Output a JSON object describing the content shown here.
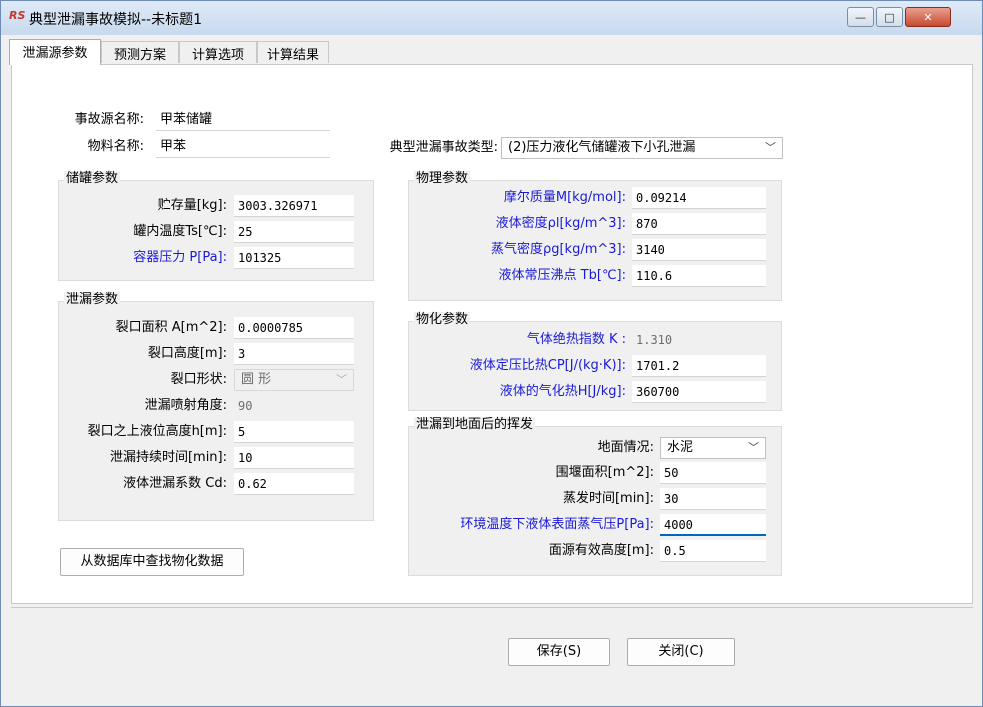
{
  "window": {
    "title": "典型泄漏事故模拟--未标题1",
    "app_icon": "RS"
  },
  "tabs": [
    "泄漏源参数",
    "预测方案",
    "计算选项",
    "计算结果"
  ],
  "form": {
    "source_name_label": "事故源名称:",
    "source_name": "甲苯储罐",
    "material_label": "物料名称:",
    "material": "甲苯",
    "accident_type_label": "典型泄漏事故类型:",
    "accident_type": "(2)压力液化气储罐液下小孔泄漏"
  },
  "tank": {
    "title": "储罐参数",
    "storage_label": "贮存量[kg]:",
    "storage": "3003.326971",
    "temp_label": "罐内温度Ts[℃]:",
    "temp": "25",
    "pressure_label": "容器压力 P[Pa]:",
    "pressure": "101325"
  },
  "leak": {
    "title": "泄漏参数",
    "area_label": "裂口面积 A[m^2]:",
    "area": "0.0000785",
    "height_label": "裂口高度[m]:",
    "height": "3",
    "shape_label": "裂口形状:",
    "shape": "圆  形",
    "angle_label": "泄漏喷射角度:",
    "angle": "90",
    "level_label": "裂口之上液位高度h[m]:",
    "level": "5",
    "duration_label": "泄漏持续时间[min]:",
    "duration": "10",
    "coef_label": "液体泄漏系数  Cd:",
    "coef": "0.62"
  },
  "physical": {
    "title": "物理参数",
    "molar_label": "摩尔质量M[kg/mol]:",
    "molar": "0.09214",
    "liquid_density_label": "液体密度ρl[kg/m^3]:",
    "liquid_density": "870",
    "vapor_density_label": "蒸气密度ρg[kg/m^3]:",
    "vapor_density": "3140",
    "boiling_label": "液体常压沸点 Tb[℃]:",
    "boiling": "110.6"
  },
  "chemical": {
    "title": "物化参数",
    "adiabatic_label": "气体绝热指数  K :",
    "adiabatic": "1.310",
    "cp_label": "液体定压比热CP[J/(kg·K)]:",
    "cp": "1701.2",
    "vaporization_label": "液体的气化热H[J/kg]:",
    "vaporization": "360700"
  },
  "evaporation": {
    "title": "泄漏到地面后的挥发",
    "ground_label": "地面情况:",
    "ground": "水泥",
    "dike_label": "围堰面积[m^2]:",
    "dike": "50",
    "time_label": "蒸发时间[min]:",
    "time": "30",
    "vapor_pressure_label": "环境温度下液体表面蒸气压P[Pa]:",
    "vapor_pressure": "4000",
    "height_label": "面源有效高度[m]:",
    "height": "0.5"
  },
  "buttons": {
    "lookup": "从数据库中查找物化数据",
    "save": "保存(S)",
    "close": "关闭(C)"
  }
}
